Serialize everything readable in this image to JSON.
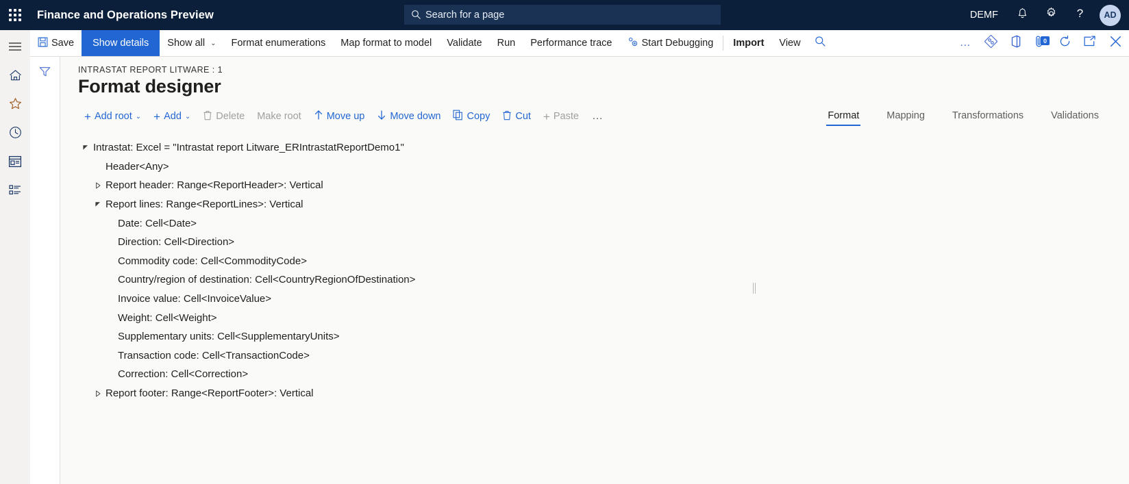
{
  "topnav": {
    "waffle_label": "app-launcher",
    "app_title": "Finance and Operations Preview",
    "search": {
      "placeholder": "Search for a page",
      "icon": "search-icon"
    },
    "company": "DEMF",
    "icons": [
      {
        "name": "notifications-icon",
        "glyph": "bell"
      },
      {
        "name": "settings-icon",
        "glyph": "gear"
      },
      {
        "name": "help-icon",
        "glyph": "question"
      }
    ],
    "avatar_initials": "AD"
  },
  "rail": {
    "items": [
      {
        "name": "navigation-menu",
        "icon": "hamburger-icon"
      },
      {
        "name": "home",
        "icon": "home-icon"
      },
      {
        "name": "favorites",
        "icon": "star-icon"
      },
      {
        "name": "recent",
        "icon": "clock-icon"
      },
      {
        "name": "workspaces",
        "icon": "workspace-icon"
      },
      {
        "name": "modules",
        "icon": "list-icon"
      }
    ]
  },
  "commandbar": {
    "save": "Save",
    "show_details": "Show details",
    "show_all": "Show all",
    "format_enumerations": "Format enumerations",
    "map_format_to_model": "Map format to model",
    "validate": "Validate",
    "run": "Run",
    "performance_trace": "Performance trace",
    "start_debugging": "Start Debugging",
    "import": "Import",
    "view": "View",
    "overflow": "…",
    "icons": [
      {
        "name": "search-icon"
      },
      {
        "name": "overflow-menu-icon"
      },
      {
        "name": "personalize-icon"
      },
      {
        "name": "office-icon"
      },
      {
        "name": "attachments-icon",
        "badge": "0"
      },
      {
        "name": "refresh-icon"
      },
      {
        "name": "popout-icon"
      },
      {
        "name": "close-icon"
      }
    ],
    "attachments_badge": "0"
  },
  "page": {
    "caption": "INTRASTAT REPORT LITWARE : 1",
    "title": "Format designer",
    "filter_icon": "filter-icon"
  },
  "toolbar": {
    "add_root": "Add root",
    "add": "Add",
    "delete": "Delete",
    "make_root": "Make root",
    "move_up": "Move up",
    "move_down": "Move down",
    "copy": "Copy",
    "cut": "Cut",
    "paste": "Paste",
    "more": "…"
  },
  "tabs": [
    {
      "label": "Format",
      "active": true
    },
    {
      "label": "Mapping",
      "active": false
    },
    {
      "label": "Transformations",
      "active": false
    },
    {
      "label": "Validations",
      "active": false
    }
  ],
  "tree": {
    "nodes": [
      {
        "label": "Intrastat: Excel = \"Intrastat report Litware_ERIntrastatReportDemo1\"",
        "indent": 0,
        "twisty": "expanded"
      },
      {
        "label": "Header<Any>",
        "indent": 1,
        "twisty": "none"
      },
      {
        "label": "Report header: Range<ReportHeader>: Vertical",
        "indent": 1,
        "twisty": "collapsed"
      },
      {
        "label": "Report lines: Range<ReportLines>: Vertical",
        "indent": 1,
        "twisty": "expanded"
      },
      {
        "label": "Date: Cell<Date>",
        "indent": 2,
        "twisty": "none"
      },
      {
        "label": "Direction: Cell<Direction>",
        "indent": 2,
        "twisty": "none"
      },
      {
        "label": "Commodity code: Cell<CommodityCode>",
        "indent": 2,
        "twisty": "none"
      },
      {
        "label": "Country/region of destination: Cell<CountryRegionOfDestination>",
        "indent": 2,
        "twisty": "none"
      },
      {
        "label": "Invoice value: Cell<InvoiceValue>",
        "indent": 2,
        "twisty": "none"
      },
      {
        "label": "Weight: Cell<Weight>",
        "indent": 2,
        "twisty": "none"
      },
      {
        "label": "Supplementary units: Cell<SupplementaryUnits>",
        "indent": 2,
        "twisty": "none"
      },
      {
        "label": "Transaction code: Cell<TransactionCode>",
        "indent": 2,
        "twisty": "none"
      },
      {
        "label": "Correction: Cell<Correction>",
        "indent": 2,
        "twisty": "none"
      },
      {
        "label": "Report footer: Range<ReportFooter>: Vertical",
        "indent": 1,
        "twisty": "collapsed"
      }
    ]
  },
  "colors": {
    "nav_bg": "#0b1f3a",
    "accent": "#2266d3",
    "pane_bg": "#fafaf9",
    "rail_bg": "#f3f2f1"
  }
}
